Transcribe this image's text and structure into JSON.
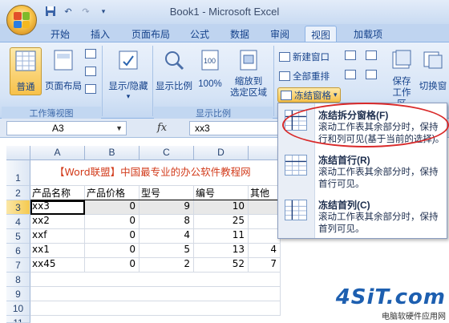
{
  "window": {
    "title": "Book1 - Microsoft Excel"
  },
  "tabs": [
    "开始",
    "插入",
    "页面布局",
    "公式",
    "数据",
    "审阅",
    "视图",
    "加载项"
  ],
  "active_tab": "视图",
  "ribbon": {
    "workbook_views": {
      "label": "工作簿视图",
      "normal": "普通",
      "page_layout": "页面布局"
    },
    "show_hide": "显示/隐藏",
    "zoom_group": {
      "label": "显示比例",
      "zoom": "显示比例",
      "hundred": "100%",
      "zoom_selection_line1": "缩放到",
      "zoom_selection_line2": "选定区域"
    },
    "window_group": {
      "new_window": "新建窗口",
      "arrange_all": "全部重排",
      "freeze_panes": "冻结窗格"
    },
    "save_workspace_line1": "保存",
    "save_workspace_line2": "工作区",
    "switch_windows": "切换窗"
  },
  "formula_bar": {
    "name_box": "A3",
    "fx": "fx",
    "content": "xx3"
  },
  "columns": [
    "A",
    "B",
    "C",
    "D"
  ],
  "rows": [
    {
      "num": "1",
      "cells": {
        "merged": "【Word联盟】中国最专业的办公软件教程网"
      }
    },
    {
      "num": "2",
      "cells": {
        "A": "产品名称",
        "B": "产品价格",
        "C": "型号",
        "D": "编号",
        "E": "其他"
      }
    },
    {
      "num": "3",
      "cells": {
        "A": "xx3",
        "B": "0",
        "C": "9",
        "D": "10"
      }
    },
    {
      "num": "4",
      "cells": {
        "A": "xx2",
        "B": "0",
        "C": "8",
        "D": "25"
      }
    },
    {
      "num": "5",
      "cells": {
        "A": "xxf",
        "B": "0",
        "C": "4",
        "D": "11"
      }
    },
    {
      "num": "6",
      "cells": {
        "A": "xx1",
        "B": "0",
        "C": "5",
        "D": "13",
        "E": "4"
      }
    },
    {
      "num": "7",
      "cells": {
        "A": "xx45",
        "B": "0",
        "C": "2",
        "D": "52",
        "E": "7"
      }
    },
    {
      "num": "8",
      "cells": {}
    },
    {
      "num": "9",
      "cells": {}
    },
    {
      "num": "10",
      "cells": {}
    },
    {
      "num": "11",
      "cells": {}
    }
  ],
  "freeze_menu": [
    {
      "title": "冻结拆分窗格(F)",
      "desc": "滚动工作表其余部分时，保持行和列可见(基于当前的选择)。"
    },
    {
      "title": "冻结首行(R)",
      "desc": "滚动工作表其余部分时，保持首行可见。"
    },
    {
      "title": "冻结首列(C)",
      "desc": "滚动工作表其余部分时，保持首列可见。"
    }
  ],
  "watermark": {
    "logo": "4SiT.com",
    "caption": "电脑软硬件应用网"
  }
}
